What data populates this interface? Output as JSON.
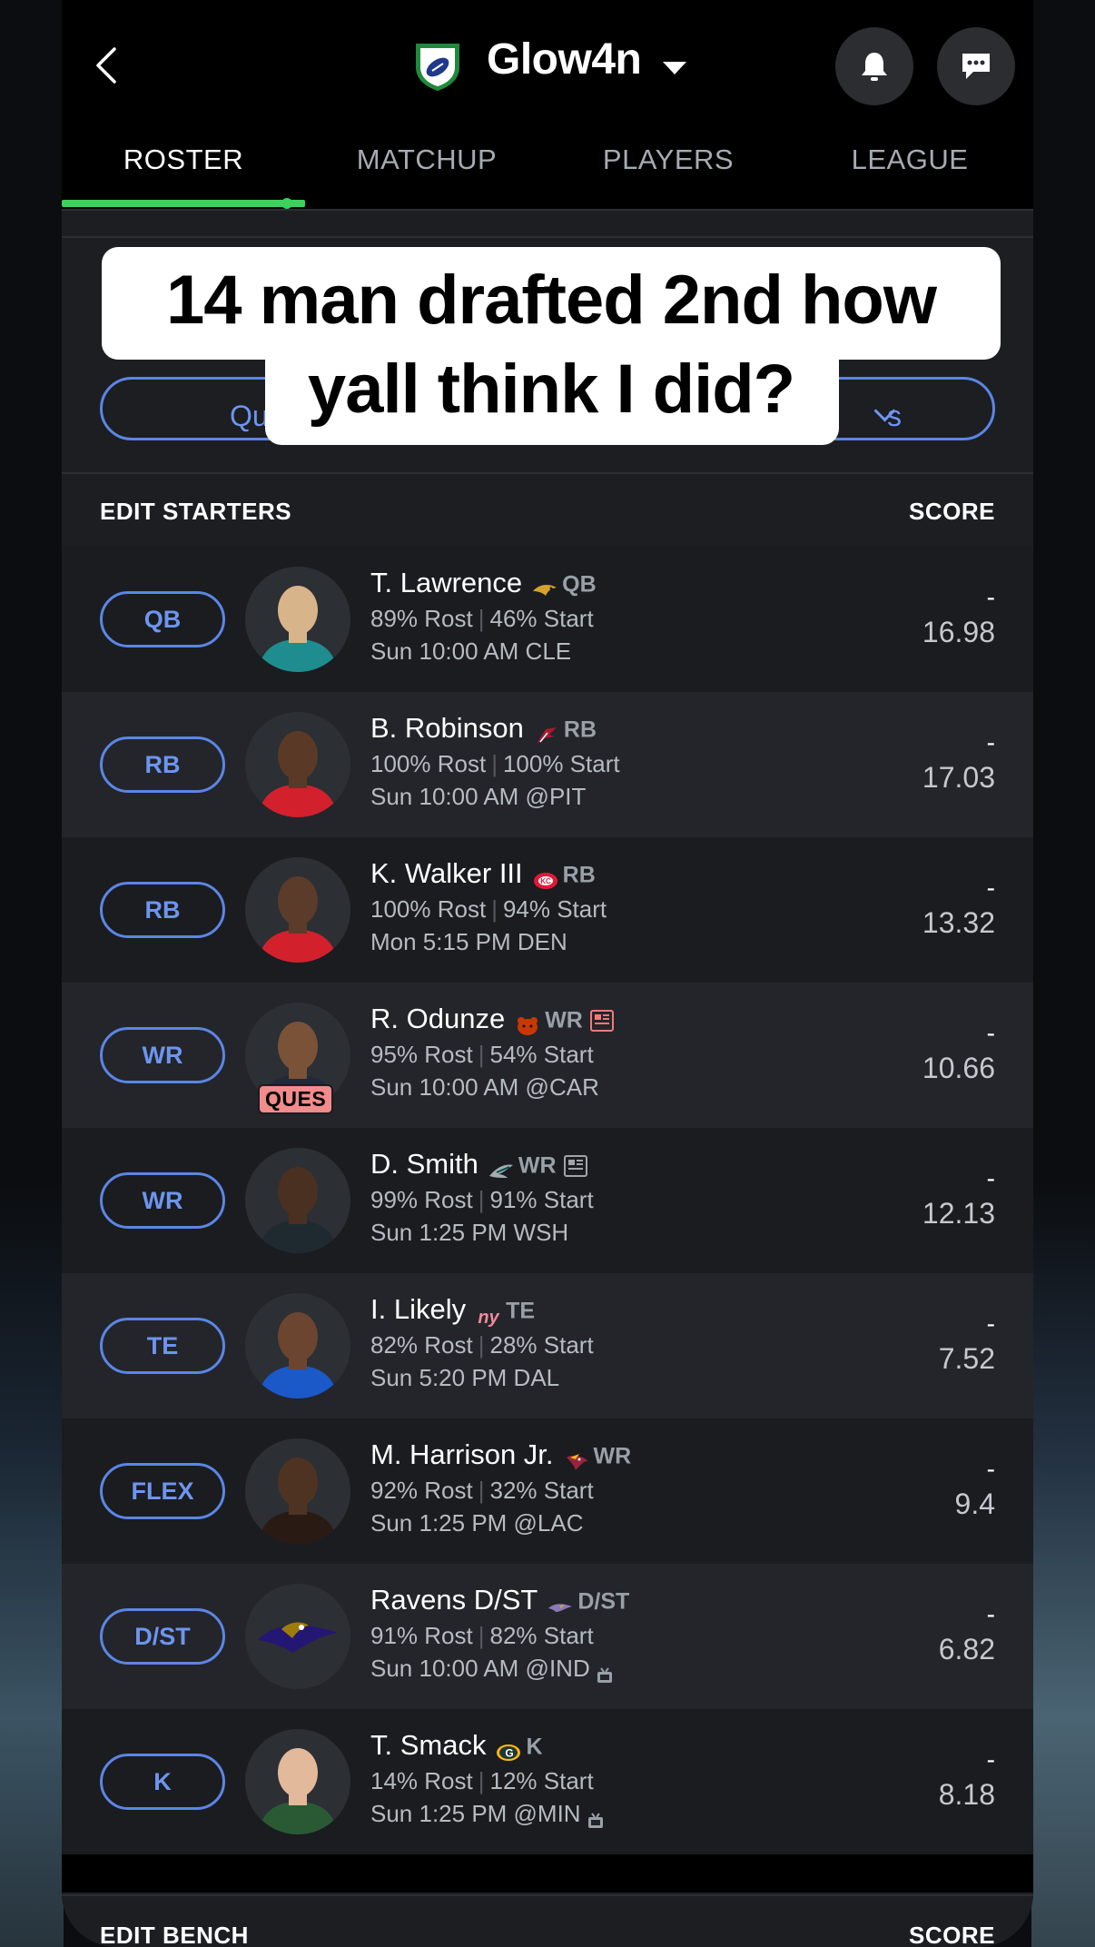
{
  "header": {
    "back_icon": "chevron-left-icon",
    "logo_icon": "football-shield-logo-icon",
    "team_name": "Glow4n",
    "dropdown_icon": "caret-down-icon",
    "bell_icon": "bell-icon",
    "chat_icon": "chat-bubble-icon"
  },
  "tabs": [
    {
      "label": "ROSTER",
      "active": true
    },
    {
      "label": "MATCHUP",
      "active": false
    },
    {
      "label": "PLAYERS",
      "active": false
    },
    {
      "label": "LEAGUE",
      "active": false
    }
  ],
  "filters": {
    "left_label": "Qu",
    "right_label": "s"
  },
  "caption": {
    "line1": "14 man drafted 2nd how",
    "line2": "yall think I did?"
  },
  "starters": {
    "header_left": "EDIT STARTERS",
    "header_right": "SCORE",
    "rows": [
      {
        "slot": "QB",
        "name": "T. Lawrence",
        "team_icon": "jaguars-logo-icon",
        "pos": "QB",
        "rost": "89% Rost",
        "start": "46% Start",
        "game": "Sun 10:00 AM CLE",
        "dash": "-",
        "score": "16.98"
      },
      {
        "slot": "RB",
        "name": "B. Robinson",
        "team_icon": "falcons-logo-icon",
        "pos": "RB",
        "rost": "100% Rost",
        "start": "100% Start",
        "game": "Sun 10:00 AM @PIT",
        "dash": "-",
        "score": "17.03"
      },
      {
        "slot": "RB",
        "name": "K. Walker III",
        "team_icon": "chiefs-logo-icon",
        "pos": "RB",
        "rost": "100% Rost",
        "start": "94% Start",
        "game": "Mon 5:15 PM DEN",
        "dash": "-",
        "score": "13.32"
      },
      {
        "slot": "WR",
        "name": "R. Odunze",
        "team_icon": "bears-logo-icon",
        "pos": "WR",
        "rost": "95% Rost",
        "start": "54% Start",
        "game": "Sun 10:00 AM @CAR",
        "dash": "-",
        "score": "10.66",
        "status": "QUES",
        "news": "red"
      },
      {
        "slot": "WR",
        "name": "D. Smith",
        "team_icon": "eagles-logo-icon",
        "pos": "WR",
        "rost": "99% Rost",
        "start": "91% Start",
        "game": "Sun 1:25 PM WSH",
        "dash": "-",
        "score": "12.13",
        "news": "gray"
      },
      {
        "slot": "TE",
        "name": "I. Likely",
        "team_icon": "giants-logo-icon",
        "team_text": "ny",
        "pos": "TE",
        "rost": "82% Rost",
        "start": "28% Start",
        "game": "Sun 5:20 PM DAL",
        "dash": "-",
        "score": "7.52"
      },
      {
        "slot": "FLEX",
        "name": "M. Harrison Jr.",
        "team_icon": "cardinals-logo-icon",
        "pos": "WR",
        "rost": "92% Rost",
        "start": "32% Start",
        "game": "Sun 1:25 PM @LAC",
        "dash": "-",
        "score": "9.4"
      },
      {
        "slot": "D/ST",
        "name": "Ravens D/ST",
        "team_icon": "ravens-logo-icon",
        "pos": "D/ST",
        "rost": "91% Rost",
        "start": "82% Start",
        "game": "Sun 10:00 AM @IND",
        "dash": "-",
        "score": "6.82",
        "tv": true
      },
      {
        "slot": "K",
        "name": "T. Smack",
        "team_icon": "packers-logo-icon",
        "pos": "K",
        "rost": "14% Rost",
        "start": "12% Start",
        "game": "Sun 1:25 PM @MIN",
        "dash": "-",
        "score": "8.18",
        "tv": true
      }
    ]
  },
  "bench": {
    "header_left": "EDIT BENCH",
    "header_right": "SCORE"
  },
  "colors": {
    "accent_green": "#3ad15c",
    "pill_blue": "#5b86e5",
    "ques_red": "#f28b8b"
  }
}
